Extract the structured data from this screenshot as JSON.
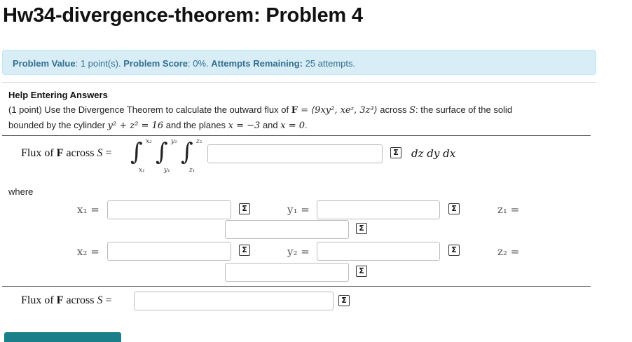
{
  "page": {
    "title": "Hw34-divergence-theorem: Problem 4"
  },
  "info": {
    "value_label": "Problem Value",
    "value_text": ": 1 point(s). ",
    "score_label": "Problem Score",
    "score_text": ": 0%. ",
    "attempts_label": "Attempts Remaining:",
    "attempts_text": " 25 attempts."
  },
  "help": {
    "heading": "Help Entering Answers"
  },
  "problem": {
    "line1_a": "(1 point) Use the Divergence Theorem to calculate the outward flux of ",
    "F": "F",
    "eq": " = ",
    "vec": "⟨9xy², xeᶻ, 3z³⟩",
    "line1_b": " across ",
    "S": "S",
    "line1_c": ": the surface of the solid",
    "line2_a": "bounded by the cylinder ",
    "cyl": "y² + z² = 16",
    "line2_b": " and the planes ",
    "planes": "x = −3",
    "and": " and ",
    "plane2": "x = 0",
    "end": "."
  },
  "flux1": {
    "label_pre": "Flux of ",
    "label_F": "F",
    "label_post": " across ",
    "label_S": "S",
    "eq": " =",
    "int_sym": "∫",
    "lim_x2": "x₂",
    "lim_x1": "x₁",
    "lim_y2": "y₂",
    "lim_y1": "y₁",
    "lim_z2": "z₂",
    "lim_z1": "z₁",
    "diff": "dz dy dx"
  },
  "where": "where",
  "bounds": {
    "x1": "x₁ =",
    "x2": "x₂ =",
    "y1": "y₁ =",
    "y2": "y₂ =",
    "z1": "z₁ =",
    "z2": "z₂ ="
  },
  "flux2": {
    "label_pre": "Flux of ",
    "label_F": "F",
    "label_post": " across ",
    "label_S": "S",
    "eq": " ="
  },
  "sigma": "Σ"
}
